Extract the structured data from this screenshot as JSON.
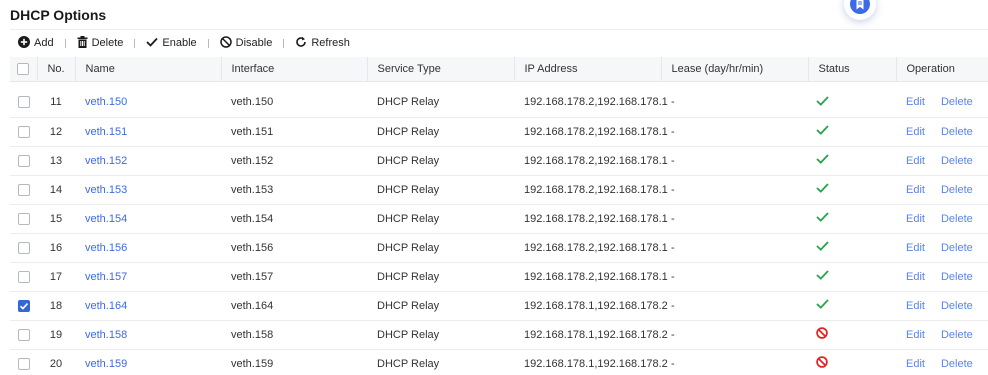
{
  "page": {
    "title": "DHCP Options"
  },
  "toolbar": {
    "add_label": "Add",
    "delete_label": "Delete",
    "enable_label": "Enable",
    "disable_label": "Disable",
    "refresh_label": "Refresh"
  },
  "colors": {
    "accent": "#3d6ae6",
    "status_enabled": "#26a44a",
    "status_disabled": "#e0241f"
  },
  "table": {
    "headers": {
      "no": "No.",
      "name": "Name",
      "interface": "Interface",
      "service_type": "Service Type",
      "ip_address": "IP Address",
      "lease": "Lease (day/hr/min)",
      "status": "Status",
      "operation": "Operation"
    },
    "edit_label": "Edit",
    "delete_label": "Delete",
    "rows": [
      {
        "no": "11",
        "name": "veth.150",
        "interface": "veth.150",
        "service_type": "DHCP Relay",
        "ip_address": "192.168.178.2,192.168.178.1",
        "lease": "-",
        "status": "enabled",
        "checked": false
      },
      {
        "no": "12",
        "name": "veth.151",
        "interface": "veth.151",
        "service_type": "DHCP Relay",
        "ip_address": "192.168.178.2,192.168.178.1",
        "lease": "-",
        "status": "enabled",
        "checked": false
      },
      {
        "no": "13",
        "name": "veth.152",
        "interface": "veth.152",
        "service_type": "DHCP Relay",
        "ip_address": "192.168.178.2,192.168.178.1",
        "lease": "-",
        "status": "enabled",
        "checked": false
      },
      {
        "no": "14",
        "name": "veth.153",
        "interface": "veth.153",
        "service_type": "DHCP Relay",
        "ip_address": "192.168.178.2,192.168.178.1",
        "lease": "-",
        "status": "enabled",
        "checked": false
      },
      {
        "no": "15",
        "name": "veth.154",
        "interface": "veth.154",
        "service_type": "DHCP Relay",
        "ip_address": "192.168.178.2,192.168.178.1",
        "lease": "-",
        "status": "enabled",
        "checked": false
      },
      {
        "no": "16",
        "name": "veth.156",
        "interface": "veth.156",
        "service_type": "DHCP Relay",
        "ip_address": "192.168.178.2,192.168.178.1",
        "lease": "-",
        "status": "enabled",
        "checked": false
      },
      {
        "no": "17",
        "name": "veth.157",
        "interface": "veth.157",
        "service_type": "DHCP Relay",
        "ip_address": "192.168.178.2,192.168.178.1",
        "lease": "-",
        "status": "enabled",
        "checked": false
      },
      {
        "no": "18",
        "name": "veth.164",
        "interface": "veth.164",
        "service_type": "DHCP Relay",
        "ip_address": "192.168.178.1,192.168.178.2",
        "lease": "-",
        "status": "enabled",
        "checked": true
      },
      {
        "no": "19",
        "name": "veth.158",
        "interface": "veth.158",
        "service_type": "DHCP Relay",
        "ip_address": "192.168.178.1,192.168.178.2",
        "lease": "-",
        "status": "disabled",
        "checked": false
      },
      {
        "no": "20",
        "name": "veth.159",
        "interface": "veth.159",
        "service_type": "DHCP Relay",
        "ip_address": "192.168.178.1,192.168.178.2",
        "lease": "-",
        "status": "disabled",
        "checked": false
      }
    ]
  }
}
